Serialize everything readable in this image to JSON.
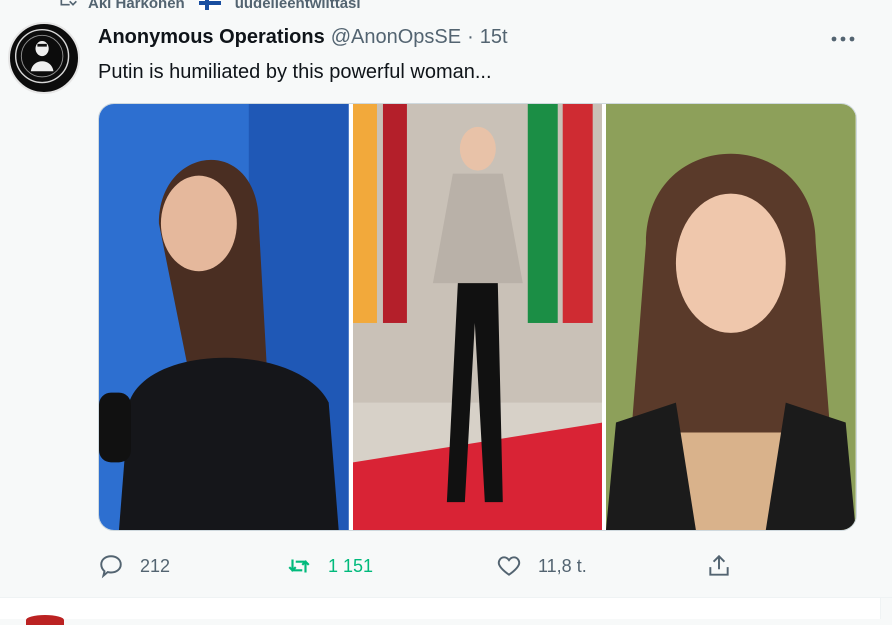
{
  "retweet_banner": {
    "user": "Aki Härkönen",
    "action": "uudelleentwiittasi"
  },
  "tweet": {
    "author_name": "Anonymous Operations",
    "author_handle": "@AnonOpsSE",
    "separator": "·",
    "time": "15t",
    "text": "Putin is humiliated by this powerful woman...",
    "media": [
      {
        "alt": "photo-1"
      },
      {
        "alt": "photo-2"
      },
      {
        "alt": "photo-3"
      }
    ]
  },
  "actions": {
    "reply_count": "212",
    "retweet_count": "1 151",
    "like_count": "11,8 t."
  },
  "colors": {
    "retweet_green": "#00ba7c",
    "muted": "#536471",
    "background": "#f7f9f9"
  }
}
